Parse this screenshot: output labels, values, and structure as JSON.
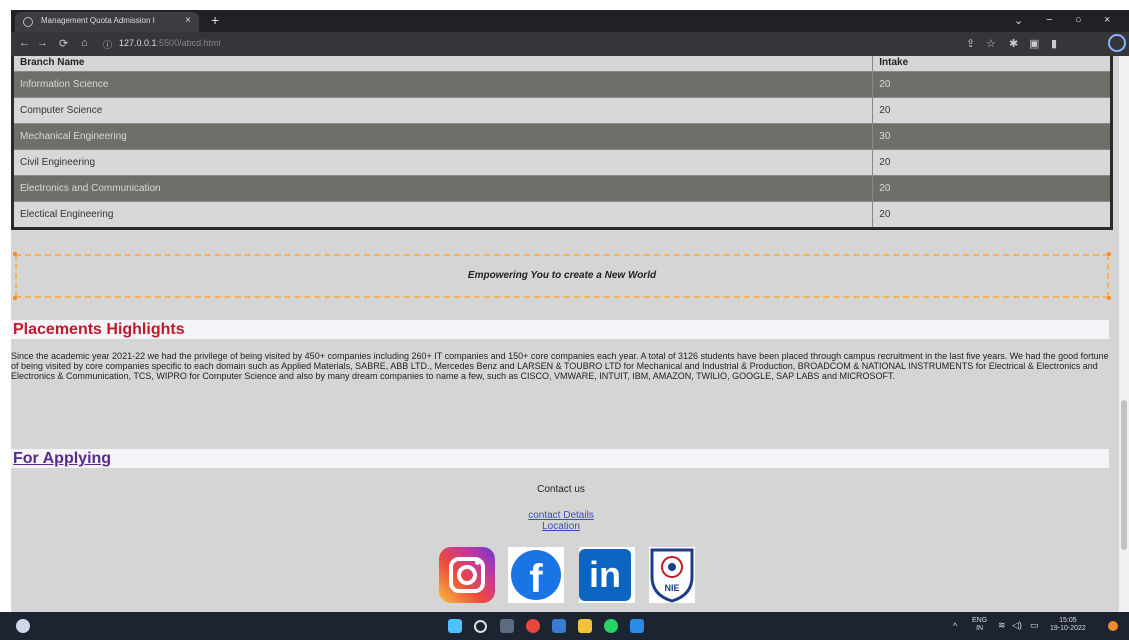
{
  "browser": {
    "tab_title": "Management Quota Admission I",
    "tab_close": "×",
    "new_tab": "+",
    "url_host": "127.0.0.1",
    "url_rest": ":5500/abcd.html",
    "window_minimize": "−",
    "window_restore": "○",
    "window_close": "×",
    "chevron": "⌄"
  },
  "table": {
    "headers": [
      "Branch Name",
      "Intake"
    ],
    "rows": [
      {
        "branch": "Information Science",
        "intake": "20"
      },
      {
        "branch": "Computer Science",
        "intake": "20"
      },
      {
        "branch": "Mechanical Engineering",
        "intake": "30"
      },
      {
        "branch": "Civil Engineering",
        "intake": "20"
      },
      {
        "branch": "Electronics and Communication",
        "intake": "20"
      },
      {
        "branch": "Electical Engineering",
        "intake": "20"
      }
    ]
  },
  "tagline": "Empowering You to create a New World",
  "placements": {
    "heading": "Placements Highlights",
    "text": "Since the academic year 2021-22 we had the privilege of being visited by 450+ companies including 260+ IT companies and 150+ core companies each year. A total of 3126 students have been placed through campus recruitment in the last five years. We had the good fortune of being visited by core companies specific to each domain such as Applied Materials, SABRE, ABB LTD., Mercedes Benz and LARSEN & TOUBRO LTD for Mechanical and Industrial & Production, BROADCOM & NATIONAL INSTRUMENTS for Electrical & Electronics and Electronics & Communication, TCS, WIPRO for Computer Science and also by many dream companies to name a few, such as CISCO, VMWARE, INTUIT, IBM, AMAZON, TWILIO, GOOGLE, SAP LABS and MICROSOFT."
  },
  "applying": {
    "heading": "For Applying",
    "contact_title": "Contact us",
    "contact_details_link": "contact Details",
    "location_link": "Location"
  },
  "social": {
    "facebook_glyph": "f",
    "linkedin_glyph": "in",
    "nie_logo_text": "NIE"
  },
  "taskbar": {
    "lang_top": "ENG",
    "lang_bottom": "IN",
    "time": "15:05",
    "date": "19-10-2022"
  }
}
